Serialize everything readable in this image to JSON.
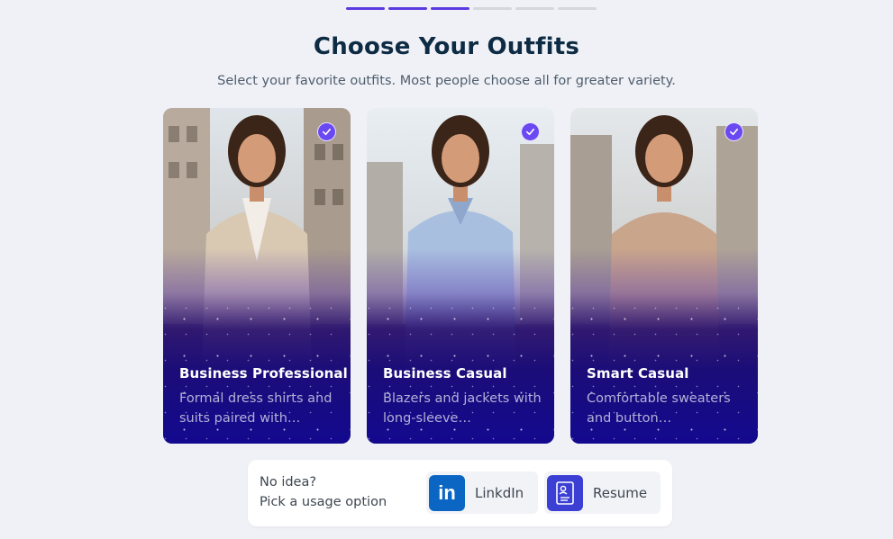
{
  "progress": {
    "total_steps": 6,
    "completed_steps": 3
  },
  "header": {
    "title": "Choose Your Outfits",
    "subtitle": "Select your favorite outfits. Most people choose all for greater variety."
  },
  "outfits": [
    {
      "title": "Business Professional",
      "description": "Formal dress shirts and suits paired with…",
      "selected": true,
      "clothing_color": "#d9c9b3",
      "top_color": "#f2ede6"
    },
    {
      "title": "Business Casual",
      "description": "Blazers and jackets with long-sleeve…",
      "selected": true,
      "clothing_color": "#a9bfe0",
      "top_color": "#a9bfe0"
    },
    {
      "title": "Smart Casual",
      "description": "Comfortable sweaters and button…",
      "selected": true,
      "clothing_color": "#c9a58c",
      "top_color": "#c9a58c"
    }
  ],
  "usage": {
    "line1": "No idea?",
    "line2": "Pick a usage option",
    "options": [
      {
        "label": "LinkdIn",
        "icon": "linkedin-icon",
        "icon_text": "in"
      },
      {
        "label": "Resume",
        "icon": "resume-icon"
      }
    ]
  },
  "colors": {
    "accent": "#5b3be0",
    "check": "#6a48f2",
    "card_bottom": "#13098f",
    "title": "#0e2b44"
  }
}
